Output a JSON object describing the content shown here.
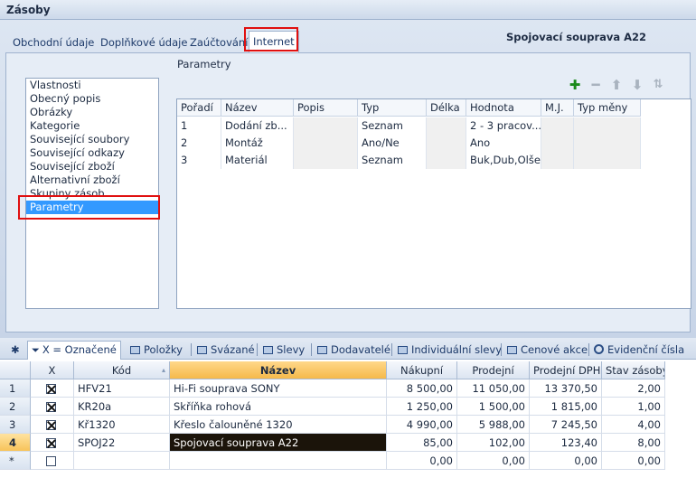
{
  "window": {
    "title": "Zásoby"
  },
  "detail": {
    "tabs": [
      {
        "label": "Obchodní údaje"
      },
      {
        "label": "Doplňkové údaje"
      },
      {
        "label": "Zaúčtování"
      },
      {
        "label": "Internet"
      }
    ],
    "record_title": "Spojovací souprava A22",
    "nav_items": [
      "Vlastnosti",
      "Obecný popis",
      "Obrázky",
      "Kategorie",
      "Související soubory",
      "Související odkazy",
      "Související zboží",
      "Alternativní zboží",
      "Skupiny zásob",
      "Parametry"
    ],
    "selected_nav": "Parametry",
    "parameters": {
      "group_label": "Parametry",
      "toolbar_icons": [
        "add-icon",
        "remove-icon",
        "move-up-icon",
        "move-down-icon",
        "sort-icon"
      ],
      "columns": [
        "Pořadí",
        "Název",
        "Popis",
        "Typ",
        "Délka",
        "Hodnota",
        "M.J.",
        "Typ měny"
      ],
      "rows": [
        [
          "1",
          "Dodání zb...",
          "",
          "Seznam",
          "",
          "2 - 3 pracov...",
          "",
          ""
        ],
        [
          "2",
          "Montáž",
          "",
          "Ano/Ne",
          "",
          "Ano",
          "",
          ""
        ],
        [
          "3",
          "Materiál",
          "",
          "Seznam",
          "",
          "Buk,Dub,Olše",
          "",
          ""
        ]
      ]
    }
  },
  "bottom_tabs": [
    {
      "label": "X = Označené"
    },
    {
      "label": "Položky"
    },
    {
      "label": "Svázané"
    },
    {
      "label": "Slevy"
    },
    {
      "label": "Dodavatelé"
    },
    {
      "label": "Individuální slevy"
    },
    {
      "label": "Cenové akce"
    },
    {
      "label": "Evidenční čísla"
    }
  ],
  "grid": {
    "columns": [
      "X",
      "Kód",
      "Název",
      "Nákupní",
      "Prodejní",
      "Prodejní DPH",
      "Stav zásoby"
    ],
    "rows": [
      {
        "n": "1",
        "checked": true,
        "kod": "HFV21",
        "nazev": "Hi-Fi souprava SONY",
        "nakupni": "8 500,00",
        "prodejni": "11 050,00",
        "dph": "13 370,50",
        "stav": "2,00"
      },
      {
        "n": "2",
        "checked": true,
        "kod": "KR20a",
        "nazev": "Skříňka rohová",
        "nakupni": "1 250,00",
        "prodejni": "1 500,00",
        "dph": "1 815,00",
        "stav": "1,00"
      },
      {
        "n": "3",
        "checked": true,
        "kod": "Kř1320",
        "nazev": "Křeslo čalouněné 1320",
        "nakupni": "4 990,00",
        "prodejni": "5 988,00",
        "dph": "7 245,50",
        "stav": "4,00"
      },
      {
        "n": "4",
        "checked": true,
        "kod": "SPOJ22",
        "nazev": "Spojovací souprava A22",
        "nakupni": "85,00",
        "prodejni": "102,00",
        "dph": "123,40",
        "stav": "8,00"
      },
      {
        "n": "*",
        "checked": false,
        "kod": "",
        "nazev": "",
        "nakupni": "0,00",
        "prodejni": "0,00",
        "dph": "0,00",
        "stav": "0,00"
      }
    ]
  },
  "colors": {
    "selection": "#3399ff",
    "highlight": "#e01010",
    "add": "#1a8a1a",
    "sorted_header": "#f5b94a"
  }
}
